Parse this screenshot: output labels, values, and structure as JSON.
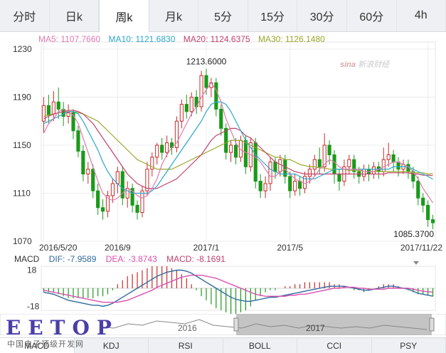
{
  "tabs": [
    {
      "label": "分时",
      "active": false
    },
    {
      "label": "日k",
      "active": false
    },
    {
      "label": "周k",
      "active": true
    },
    {
      "label": "月k",
      "active": false
    },
    {
      "label": "5分",
      "active": false
    },
    {
      "label": "15分",
      "active": false
    },
    {
      "label": "30分",
      "active": false
    },
    {
      "label": "60分",
      "active": false
    },
    {
      "label": "4h",
      "active": false
    }
  ],
  "legend": {
    "ma5": "MA5: 1107.7660",
    "ma10": "MA10: 1121.6830",
    "ma20": "MA20: 1124.6375",
    "ma30": "MA30: 1126.1480"
  },
  "watermark": {
    "brand": "sina",
    "text": "新浪财经"
  },
  "macd_legend": {
    "name": "MACD",
    "dif": "DIF: -7.9589",
    "dea": "DEA: -3.8743",
    "macd": "MACD: -8.1691"
  },
  "navigator": {
    "labels": [
      "2016",
      "2017"
    ]
  },
  "indicator_tabs": [
    {
      "label": "MACD",
      "active": true
    },
    {
      "label": "KDJ",
      "active": false
    },
    {
      "label": "RSI",
      "active": false
    },
    {
      "label": "BOLL",
      "active": false
    },
    {
      "label": "CCI",
      "active": false
    },
    {
      "label": "PSY",
      "active": false
    }
  ],
  "overlay": {
    "logo": "EETOP",
    "subtitle": "中国电子顶级开发网"
  },
  "colors": {
    "up": "#c92b2b",
    "down": "#1a9a1a",
    "ma5": "#e07ab0",
    "ma10": "#2aa8c8",
    "ma20": "#c2406a",
    "ma30": "#9aa62a",
    "dif": "#2f6a9e",
    "dea": "#d94fb0"
  },
  "chart_data": {
    "type": "candlestick",
    "ylim": [
      1070,
      1230
    ],
    "yticks": [
      1070,
      1110,
      1150,
      1190,
      1230
    ],
    "xticks": [
      {
        "label": "2016/5/20",
        "index": 0
      },
      {
        "label": "2016/9",
        "index": 15
      },
      {
        "label": "2017/1",
        "index": 33
      },
      {
        "label": "2017/5",
        "index": 50
      },
      {
        "label": "2017/11/22",
        "index": 78
      }
    ],
    "annotations": [
      {
        "label": "1213.6000",
        "index": 33,
        "value": 1213.6
      },
      {
        "label": "1085.3700",
        "index": 79,
        "value": 1085.37
      }
    ],
    "candles": [
      [
        1170,
        1183,
        1160,
        1190
      ],
      [
        1183,
        1175,
        1168,
        1192
      ],
      [
        1176,
        1186,
        1170,
        1195
      ],
      [
        1186,
        1180,
        1172,
        1198
      ],
      [
        1180,
        1174,
        1166,
        1186
      ],
      [
        1174,
        1177,
        1168,
        1184
      ],
      [
        1177,
        1162,
        1155,
        1180
      ],
      [
        1162,
        1145,
        1140,
        1166
      ],
      [
        1145,
        1126,
        1120,
        1150
      ],
      [
        1126,
        1130,
        1118,
        1136
      ],
      [
        1130,
        1112,
        1106,
        1134
      ],
      [
        1112,
        1098,
        1092,
        1118
      ],
      [
        1098,
        1095,
        1088,
        1105
      ],
      [
        1095,
        1108,
        1090,
        1112
      ],
      [
        1108,
        1118,
        1102,
        1122
      ],
      [
        1118,
        1128,
        1110,
        1132
      ],
      [
        1128,
        1106,
        1100,
        1132
      ],
      [
        1106,
        1114,
        1098,
        1120
      ],
      [
        1114,
        1100,
        1094,
        1118
      ],
      [
        1100,
        1094,
        1088,
        1104
      ],
      [
        1094,
        1112,
        1090,
        1116
      ],
      [
        1112,
        1130,
        1108,
        1136
      ],
      [
        1130,
        1140,
        1124,
        1144
      ],
      [
        1140,
        1150,
        1134,
        1152
      ],
      [
        1150,
        1144,
        1138,
        1156
      ],
      [
        1144,
        1152,
        1140,
        1158
      ],
      [
        1152,
        1148,
        1142,
        1156
      ],
      [
        1148,
        1170,
        1144,
        1174
      ],
      [
        1170,
        1184,
        1164,
        1188
      ],
      [
        1184,
        1178,
        1172,
        1192
      ],
      [
        1178,
        1190,
        1174,
        1194
      ],
      [
        1190,
        1182,
        1176,
        1196
      ],
      [
        1182,
        1208,
        1178,
        1212
      ],
      [
        1208,
        1198,
        1192,
        1213.6
      ],
      [
        1198,
        1202,
        1190,
        1206
      ],
      [
        1202,
        1180,
        1174,
        1206
      ],
      [
        1180,
        1164,
        1158,
        1184
      ],
      [
        1164,
        1144,
        1138,
        1168
      ],
      [
        1144,
        1150,
        1136,
        1154
      ],
      [
        1150,
        1140,
        1134,
        1156
      ],
      [
        1140,
        1154,
        1136,
        1158
      ],
      [
        1154,
        1132,
        1126,
        1158
      ],
      [
        1132,
        1152,
        1128,
        1156
      ],
      [
        1152,
        1120,
        1114,
        1156
      ],
      [
        1120,
        1112,
        1106,
        1126
      ],
      [
        1112,
        1118,
        1106,
        1124
      ],
      [
        1118,
        1136,
        1112,
        1140
      ],
      [
        1136,
        1128,
        1122,
        1140
      ],
      [
        1128,
        1138,
        1124,
        1142
      ],
      [
        1138,
        1124,
        1118,
        1142
      ],
      [
        1124,
        1112,
        1106,
        1128
      ],
      [
        1112,
        1120,
        1108,
        1126
      ],
      [
        1120,
        1114,
        1108,
        1124
      ],
      [
        1114,
        1124,
        1110,
        1128
      ],
      [
        1124,
        1130,
        1118,
        1134
      ],
      [
        1130,
        1138,
        1124,
        1142
      ],
      [
        1138,
        1132,
        1126,
        1148
      ],
      [
        1132,
        1150,
        1128,
        1160
      ],
      [
        1150,
        1142,
        1134,
        1154
      ],
      [
        1142,
        1126,
        1118,
        1146
      ],
      [
        1126,
        1120,
        1112,
        1130
      ],
      [
        1120,
        1132,
        1116,
        1138
      ],
      [
        1132,
        1138,
        1126,
        1142
      ],
      [
        1138,
        1128,
        1122,
        1142
      ],
      [
        1128,
        1124,
        1118,
        1132
      ],
      [
        1124,
        1130,
        1120,
        1134
      ],
      [
        1130,
        1126,
        1120,
        1134
      ],
      [
        1126,
        1132,
        1122,
        1136
      ],
      [
        1132,
        1128,
        1122,
        1136
      ],
      [
        1128,
        1138,
        1124,
        1148
      ],
      [
        1138,
        1142,
        1132,
        1152
      ],
      [
        1142,
        1136,
        1128,
        1146
      ],
      [
        1136,
        1130,
        1124,
        1140
      ],
      [
        1130,
        1134,
        1126,
        1138
      ],
      [
        1134,
        1128,
        1122,
        1138
      ],
      [
        1128,
        1120,
        1114,
        1132
      ],
      [
        1120,
        1106,
        1100,
        1124
      ],
      [
        1106,
        1100,
        1094,
        1110
      ],
      [
        1100,
        1088,
        1082,
        1104
      ],
      [
        1088,
        1085.37,
        1080,
        1092
      ]
    ],
    "ma5": [
      1160,
      1168,
      1172,
      1178,
      1180,
      1178,
      1175,
      1168,
      1156,
      1144,
      1132,
      1120,
      1110,
      1106,
      1104,
      1106,
      1110,
      1114,
      1112,
      1108,
      1106,
      1108,
      1114,
      1122,
      1134,
      1142,
      1148,
      1152,
      1160,
      1168,
      1176,
      1182,
      1190,
      1196,
      1202,
      1196,
      1186,
      1172,
      1162,
      1152,
      1146,
      1144,
      1142,
      1140,
      1136,
      1130,
      1124,
      1124,
      1128,
      1130,
      1126,
      1122,
      1120,
      1118,
      1120,
      1124,
      1130,
      1134,
      1138,
      1136,
      1132,
      1130,
      1130,
      1130,
      1130,
      1128,
      1128,
      1128,
      1130,
      1132,
      1134,
      1136,
      1136,
      1134,
      1132,
      1128,
      1122,
      1114,
      1108,
      1102
    ],
    "ma10": [
      1168,
      1170,
      1172,
      1174,
      1176,
      1178,
      1178,
      1176,
      1170,
      1162,
      1154,
      1146,
      1136,
      1128,
      1122,
      1118,
      1114,
      1112,
      1110,
      1110,
      1110,
      1110,
      1112,
      1116,
      1122,
      1128,
      1134,
      1140,
      1146,
      1152,
      1158,
      1164,
      1170,
      1178,
      1184,
      1186,
      1186,
      1184,
      1178,
      1170,
      1162,
      1154,
      1148,
      1142,
      1138,
      1134,
      1130,
      1128,
      1126,
      1126,
      1126,
      1126,
      1124,
      1122,
      1122,
      1122,
      1124,
      1126,
      1128,
      1130,
      1130,
      1130,
      1130,
      1130,
      1130,
      1130,
      1130,
      1130,
      1130,
      1130,
      1130,
      1132,
      1132,
      1132,
      1132,
      1130,
      1128,
      1126,
      1124,
      1121.68
    ],
    "ma20": [
      1172,
      1174,
      1176,
      1177,
      1178,
      1179,
      1179,
      1178,
      1176,
      1172,
      1168,
      1162,
      1156,
      1150,
      1144,
      1138,
      1132,
      1126,
      1122,
      1118,
      1116,
      1114,
      1114,
      1114,
      1116,
      1118,
      1120,
      1122,
      1126,
      1130,
      1134,
      1138,
      1142,
      1148,
      1154,
      1158,
      1160,
      1162,
      1164,
      1164,
      1162,
      1158,
      1156,
      1152,
      1148,
      1144,
      1140,
      1136,
      1134,
      1132,
      1130,
      1128,
      1127,
      1126,
      1126,
      1126,
      1126,
      1126,
      1126,
      1126,
      1126,
      1126,
      1126,
      1126,
      1126,
      1126,
      1126,
      1126,
      1126,
      1126,
      1127,
      1127,
      1127,
      1127,
      1127,
      1126,
      1126,
      1125,
      1125,
      1124.64
    ],
    "ma30": [
      1174,
      1175,
      1176,
      1177,
      1178,
      1178,
      1178,
      1177,
      1176,
      1174,
      1172,
      1170,
      1166,
      1162,
      1158,
      1154,
      1150,
      1146,
      1142,
      1138,
      1136,
      1134,
      1132,
      1130,
      1130,
      1130,
      1130,
      1132,
      1134,
      1136,
      1138,
      1140,
      1142,
      1144,
      1146,
      1148,
      1150,
      1152,
      1154,
      1154,
      1154,
      1152,
      1150,
      1148,
      1146,
      1144,
      1142,
      1140,
      1140,
      1138,
      1138,
      1136,
      1134,
      1133,
      1132,
      1132,
      1131,
      1131,
      1130,
      1130,
      1130,
      1130,
      1129,
      1129,
      1129,
      1128,
      1128,
      1128,
      1128,
      1128,
      1128,
      1128,
      1128,
      1128,
      1128,
      1127,
      1127,
      1127,
      1126,
      1126.15
    ]
  },
  "macd_chart": {
    "ylim": [
      -22,
      22
    ],
    "yticks": [
      18,
      -18
    ],
    "dif": [
      -4,
      -5,
      -6,
      -8,
      -10,
      -12,
      -13,
      -14,
      -15,
      -16,
      -17,
      -17,
      -18,
      -17,
      -15,
      -12,
      -9,
      -6,
      -3,
      0,
      3,
      6,
      9,
      12,
      14,
      16,
      17,
      18,
      18,
      17,
      15,
      12,
      9,
      6,
      3,
      0,
      -3,
      -6,
      -9,
      -11,
      -12,
      -13,
      -13,
      -12,
      -11,
      -10,
      -9,
      -9,
      -8,
      -7,
      -6,
      -5,
      -4,
      -3,
      -2,
      -1,
      0,
      1,
      2,
      2,
      2,
      2,
      1,
      0,
      -1,
      -2,
      -2,
      -1,
      0,
      1,
      2,
      2,
      1,
      0,
      -1,
      -3,
      -5,
      -6,
      -7,
      -7.96
    ],
    "dea": [
      -2,
      -3,
      -4,
      -5,
      -6,
      -7,
      -8,
      -9,
      -10,
      -11,
      -12,
      -13,
      -14,
      -14,
      -14,
      -14,
      -13,
      -12,
      -10,
      -8,
      -6,
      -4,
      -2,
      1,
      3,
      5,
      7,
      9,
      11,
      12,
      13,
      13,
      13,
      12,
      11,
      10,
      8,
      6,
      4,
      2,
      0,
      -2,
      -4,
      -6,
      -7,
      -8,
      -8,
      -8,
      -8,
      -8,
      -7,
      -7,
      -6,
      -6,
      -5,
      -4,
      -3,
      -2,
      -1,
      0,
      0,
      1,
      1,
      1,
      0,
      0,
      -1,
      -1,
      -1,
      -1,
      0,
      0,
      0,
      0,
      0,
      -1,
      -2,
      -3,
      -3.5,
      -3.87
    ],
    "macd": [
      -4,
      -4,
      -4,
      -6,
      -8,
      -10,
      -10,
      -10,
      -10,
      -10,
      -10,
      -8,
      -8,
      -6,
      -2,
      4,
      8,
      12,
      14,
      16,
      18,
      20,
      22,
      22,
      22,
      22,
      20,
      18,
      14,
      10,
      4,
      -2,
      -8,
      -12,
      -16,
      -20,
      -22,
      -24,
      -26,
      -26,
      -24,
      -22,
      -18,
      -12,
      -8,
      -4,
      -2,
      -2,
      0,
      2,
      2,
      4,
      4,
      6,
      6,
      6,
      6,
      6,
      6,
      4,
      4,
      2,
      0,
      -2,
      -2,
      -4,
      -2,
      0,
      2,
      4,
      4,
      4,
      2,
      0,
      -2,
      -4,
      -6,
      -6,
      -7,
      -8.17
    ]
  }
}
